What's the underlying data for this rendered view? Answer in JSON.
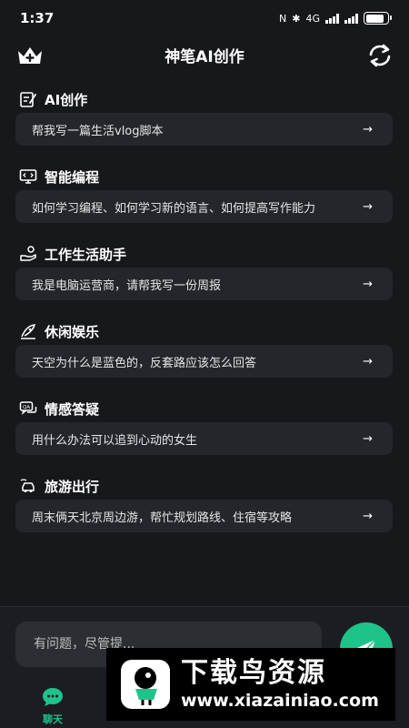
{
  "status": {
    "time": "1:37",
    "nfc_label": "N",
    "bluetooth_label": "✱",
    "network_label": "4G",
    "battery_level": 0.85
  },
  "header": {
    "title": "神笔AI创作",
    "crown_icon": "crown-icon",
    "refresh_icon": "refresh-icon"
  },
  "sections": [
    {
      "title": "AI创作",
      "icon": "edit-icon",
      "prompt": "帮我写一篇生活vlog脚本",
      "arrow": "→"
    },
    {
      "title": "智能编程",
      "icon": "monitor-code-icon",
      "prompt": "如何学习编程、如何学习新的语言、如何提高写作能力",
      "arrow": "→"
    },
    {
      "title": "工作生活助手",
      "icon": "hand-coin-icon",
      "prompt": "我是电脑运营商，请帮我写一份周报",
      "arrow": "→"
    },
    {
      "title": "休闲娱乐",
      "icon": "leisure-icon",
      "prompt": "天空为什么是蓝色的，反套路应该怎么回答",
      "arrow": "→"
    },
    {
      "title": "情感答疑",
      "icon": "qa-chat-icon",
      "prompt": "用什么办法可以追到心动的女生",
      "arrow": "→"
    },
    {
      "title": "旅游出行",
      "icon": "travel-car-icon",
      "prompt": "周末俩天北京周边游，帮忙规划路线、住宿等攻略",
      "arrow": "→"
    }
  ],
  "input": {
    "placeholder": "有问题，尽管提..."
  },
  "tabs": [
    {
      "label": "聊天",
      "active": true
    }
  ],
  "watermark": {
    "title": "下载鸟资源",
    "url": "www.xiazainiao.com"
  },
  "colors": {
    "background": "#17181c",
    "card": "#24262b",
    "accent": "#1ec38a"
  }
}
